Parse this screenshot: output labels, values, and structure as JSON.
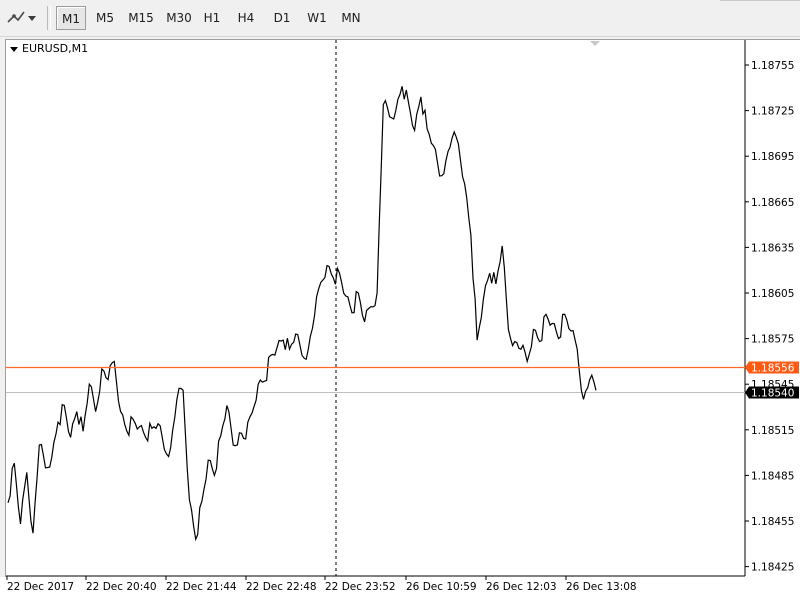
{
  "toolbar": {
    "timeframes": [
      {
        "label": "M1",
        "active": true
      },
      {
        "label": "M5",
        "active": false
      },
      {
        "label": "M15",
        "active": false
      },
      {
        "label": "M30",
        "active": false
      },
      {
        "label": "H1",
        "active": false
      },
      {
        "label": "H4",
        "active": false
      },
      {
        "label": "D1",
        "active": false
      },
      {
        "label": "W1",
        "active": false
      },
      {
        "label": "MN",
        "active": false
      }
    ]
  },
  "chart": {
    "title": "EURUSD,M1",
    "price_levels": [
      "1.18755",
      "1.18725",
      "1.18695",
      "1.18665",
      "1.18635",
      "1.18605",
      "1.18575",
      "1.18545",
      "1.18515",
      "1.18485",
      "1.18455",
      "1.18425"
    ],
    "time_labels": [
      "22 Dec 2017",
      "22 Dec 20:40",
      "22 Dec 21:44",
      "22 Dec 22:48",
      "22 Dec 23:52",
      "26 Dec 10:59",
      "26 Dec 12:03",
      "26 Dec 13:08"
    ],
    "ask_label": "1.18556",
    "bid_label": "1.18540",
    "colors": {
      "ask_line": "#ff6a2a",
      "ask_badge": "#ff5a14",
      "bid_line": "#c0c0c0",
      "bid_badge": "#000000",
      "price_series": "#000000"
    }
  },
  "chart_data": {
    "type": "line",
    "title": "EURUSD,M1",
    "xlabel": "",
    "ylabel": "",
    "ylim": [
      1.18417,
      1.18772
    ],
    "x": [
      "22 Dec 2017",
      "22 Dec 20:40",
      "22 Dec 21:44",
      "22 Dec 22:48",
      "22 Dec 23:52",
      "26 Dec 10:59",
      "26 Dec 12:03",
      "26 Dec 13:08"
    ],
    "series": [
      {
        "points": [
          [
            0,
            1.18467
          ],
          [
            1,
            1.18493
          ],
          [
            2,
            1.18453
          ],
          [
            3,
            1.18487
          ],
          [
            4,
            1.18447
          ],
          [
            5,
            1.18505
          ],
          [
            6,
            1.1849
          ],
          [
            7,
            1.18497
          ],
          [
            8,
            1.1852
          ],
          [
            9,
            1.18531
          ],
          [
            10,
            1.1851
          ],
          [
            11,
            1.18527
          ],
          [
            12,
            1.18514
          ],
          [
            13,
            1.18545
          ],
          [
            14,
            1.18527
          ],
          [
            15,
            1.18555
          ],
          [
            16,
            1.18548
          ],
          [
            17,
            1.1856
          ],
          [
            18,
            1.18527
          ],
          [
            19,
            1.18514
          ],
          [
            20,
            1.18522
          ],
          [
            21,
            1.18517
          ],
          [
            22,
            1.1851
          ],
          [
            23,
            1.18516
          ],
          [
            24,
            1.18519
          ],
          [
            25,
            1.18502
          ],
          [
            26,
            1.18503
          ],
          [
            27,
            1.18535
          ],
          [
            28,
            1.18541
          ],
          [
            29,
            1.18469
          ],
          [
            30,
            1.18443
          ],
          [
            31,
            1.18468
          ],
          [
            32,
            1.18495
          ],
          [
            33,
            1.18485
          ],
          [
            34,
            1.18511
          ],
          [
            35,
            1.18531
          ],
          [
            36,
            1.18505
          ],
          [
            37,
            1.18513
          ],
          [
            38,
            1.18509
          ],
          [
            39,
            1.18526
          ],
          [
            40,
            1.18545
          ],
          [
            41,
            1.18547
          ],
          [
            42,
            1.18564
          ],
          [
            43,
            1.18569
          ],
          [
            44,
            1.18574
          ],
          [
            45,
            1.18568
          ],
          [
            46,
            1.18578
          ],
          [
            47,
            1.18564
          ],
          [
            48,
            1.18568
          ],
          [
            49,
            1.1859
          ],
          [
            50,
            1.18612
          ],
          [
            51,
            1.18623
          ],
          [
            52,
            1.18615
          ],
          [
            53,
            1.18618
          ],
          [
            54,
            1.18603
          ],
          [
            55,
            1.18592
          ],
          [
            56,
            1.18605
          ],
          [
            57,
            1.18586
          ],
          [
            58,
            1.18596
          ],
          [
            59,
            1.18605
          ],
          [
            60,
            1.18729
          ],
          [
            61,
            1.18721
          ],
          [
            62,
            1.18725
          ],
          [
            63,
            1.18741
          ],
          [
            64,
            1.18731
          ],
          [
            65,
            1.18712
          ],
          [
            66,
            1.18734
          ],
          [
            67,
            1.18713
          ],
          [
            68,
            1.18702
          ],
          [
            69,
            1.18682
          ],
          [
            70,
            1.18692
          ],
          [
            71,
            1.18707
          ],
          [
            72,
            1.18703
          ],
          [
            73,
            1.18677
          ],
          [
            74,
            1.18643
          ],
          [
            75,
            1.18574
          ],
          [
            76,
            1.18601
          ],
          [
            77,
            1.18618
          ],
          [
            78,
            1.18611
          ],
          [
            79,
            1.18636
          ],
          [
            80,
            1.18581
          ],
          [
            81,
            1.18573
          ],
          [
            82,
            1.18568
          ],
          [
            83,
            1.1856
          ],
          [
            84,
            1.18581
          ],
          [
            85,
            1.18573
          ],
          [
            86,
            1.18591
          ],
          [
            87,
            1.18585
          ],
          [
            88,
            1.18575
          ],
          [
            89,
            1.18591
          ],
          [
            90,
            1.1858
          ],
          [
            91,
            1.18568
          ],
          [
            92,
            1.18535
          ],
          [
            93,
            1.18548
          ],
          [
            94,
            1.18541
          ]
        ]
      }
    ],
    "horizontal_lines": [
      {
        "label": "1.18556",
        "value": 1.18556
      },
      {
        "label": "1.18540",
        "value": 1.1854
      }
    ],
    "vertical_marker": "22 Dec 23:52",
    "grid": false
  }
}
